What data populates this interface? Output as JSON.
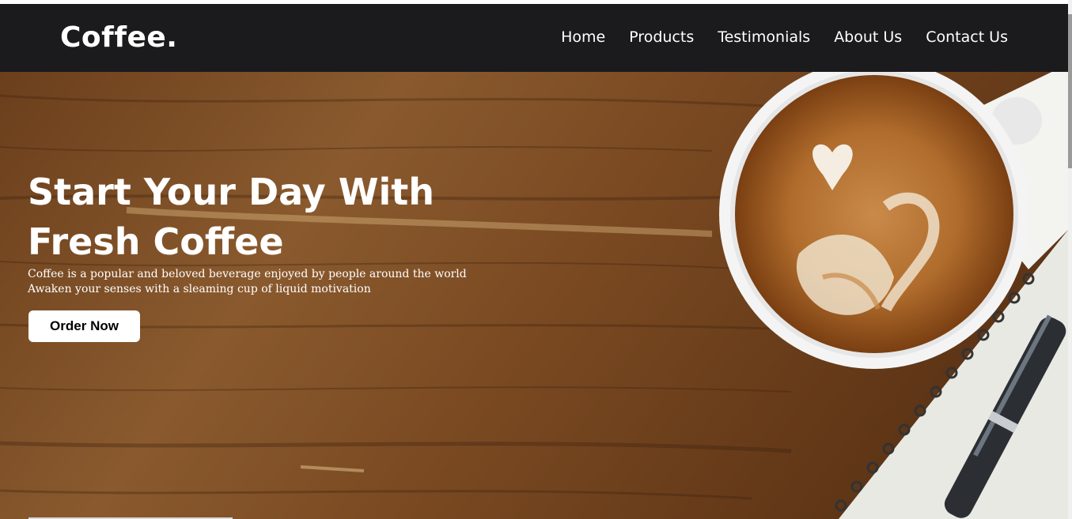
{
  "brand": {
    "logo": "Coffee."
  },
  "nav": {
    "items": [
      {
        "label": "Home"
      },
      {
        "label": "Products"
      },
      {
        "label": "Testimonials"
      },
      {
        "label": "About Us"
      },
      {
        "label": "Contact Us"
      }
    ]
  },
  "hero": {
    "title": "Start Your Day With Fresh Coffee",
    "lines": [
      "Coffee is a popular and beloved beverage enjoyed by people around the world",
      "Awaken your senses with a sleaming cup of liquid motivation"
    ],
    "cta_label": "Order Now",
    "image": "coffee-latte-on-wooden-table"
  },
  "colors": {
    "navbar": "#1b1b1e",
    "text": "#ffffff",
    "wood": "#7a4a22",
    "button": "#ffffff"
  }
}
